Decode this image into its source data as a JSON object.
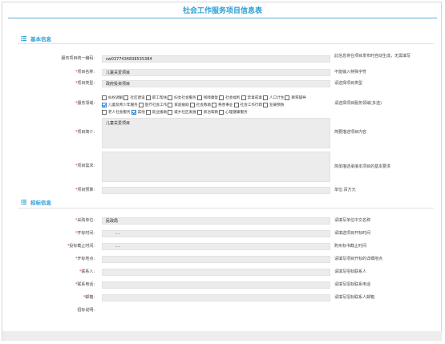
{
  "title": "社会工作服务项目信息表",
  "sections": {
    "basic": "基本信息",
    "bidding": "招标信息"
  },
  "basic": {
    "code_label": "服务项目统一编码:",
    "code_value": "sw0377434838535384",
    "code_hint": "此信息将在项目发布时自动生成，无需填写",
    "name_label": "项目名称:",
    "name_value": "儿童关爱项目",
    "name_hint": "不能输入特殊字符",
    "type_label": "项目类型:",
    "type_value": "政府投资项目",
    "type_hint": "请选择项目类型",
    "domain_label": "服务领域:",
    "domain_hint": "请选择项目服务领域(多选)",
    "domains_row1": [
      {
        "label": "纠纷调解",
        "checked": false
      },
      {
        "label": "社区建设",
        "checked": false
      },
      {
        "label": "职工帮扶",
        "checked": false
      },
      {
        "label": "妇女社会服务",
        "checked": false
      },
      {
        "label": "残障康复",
        "checked": false
      },
      {
        "label": "社会福利",
        "checked": false
      },
      {
        "label": "禁毒戒毒",
        "checked": false
      },
      {
        "label": "人口计生",
        "checked": false
      },
      {
        "label": "教育辅导",
        "checked": false
      }
    ],
    "domains_row2": [
      {
        "label": "儿童及青少年服务",
        "checked": true
      },
      {
        "label": "医疗社会工作",
        "checked": false
      },
      {
        "label": "家庭援助",
        "checked": false
      },
      {
        "label": "社会救助",
        "checked": false
      },
      {
        "label": "慈善事业",
        "checked": false
      },
      {
        "label": "社会工作行政",
        "checked": false
      },
      {
        "label": "犯罪预防",
        "checked": false
      }
    ],
    "domains_row3": [
      {
        "label": "老人社会服务",
        "checked": false
      },
      {
        "label": "其他",
        "checked": true
      },
      {
        "label": "就业援助",
        "checked": false
      },
      {
        "label": "城乡社区发展",
        "checked": false
      },
      {
        "label": "新冶帮教",
        "checked": false
      },
      {
        "label": "心理健康服务",
        "checked": false
      }
    ],
    "intro_label": "项目简介:",
    "intro_value": "儿童关爱项目",
    "intro_hint": "简要描述项目内容",
    "need_label": "项目需求:",
    "need_value": "",
    "need_hint": "简单描述承接本项目的基本要求",
    "budget_label": "项目预算:",
    "budget_value": "",
    "budget_hint": "单位:百万元"
  },
  "bidding": {
    "buyer_label": "采购单位:",
    "buyer_value": "民政局",
    "buyer_hint": "请填写单位中文名称",
    "start_label": "开标时间:",
    "start_value": "-    -",
    "start_hint": "请填选项目开标时间",
    "deadline_label": "投标截止时间:",
    "deadline_value": "-    -",
    "deadline_hint": "购买标书截止时间",
    "place_label": "开标地点:",
    "place_value": "",
    "place_hint": "请填写项目开标的详细地点",
    "contact_label": "联系人:",
    "contact_value": "",
    "contact_hint": "请填写招标联系人",
    "phone_label": "联系电话:",
    "phone_value": "",
    "phone_hint": "请填写招标联系电话",
    "email_label": "邮箱:",
    "email_value": "",
    "email_hint": "请填写招标联系人邮箱",
    "note_label": "招标说明:"
  }
}
